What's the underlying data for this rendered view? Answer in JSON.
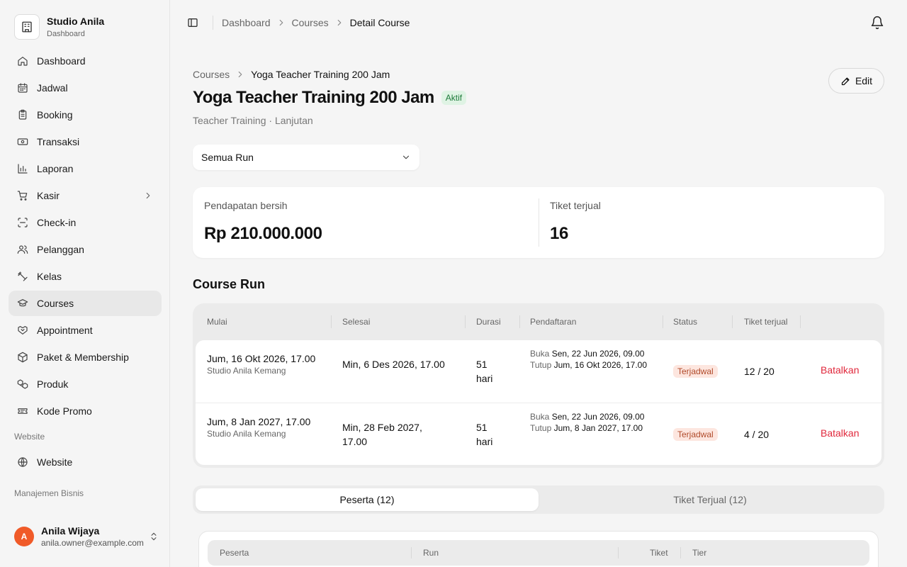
{
  "sidebar": {
    "brand": {
      "name": "Studio Anila",
      "sub": "Dashboard"
    },
    "items": [
      {
        "label": "Dashboard",
        "icon": "home-icon"
      },
      {
        "label": "Jadwal",
        "icon": "calendar-icon"
      },
      {
        "label": "Booking",
        "icon": "clipboard-icon"
      },
      {
        "label": "Transaksi",
        "icon": "banknote-icon"
      },
      {
        "label": "Laporan",
        "icon": "bar-chart-icon"
      },
      {
        "label": "Kasir",
        "icon": "cart-icon"
      },
      {
        "label": "Check-in",
        "icon": "scan-icon"
      },
      {
        "label": "Pelanggan",
        "icon": "users-icon"
      },
      {
        "label": "Kelas",
        "icon": "dumbbell-icon"
      },
      {
        "label": "Courses",
        "icon": "graduation-cap-icon"
      },
      {
        "label": "Appointment",
        "icon": "handshake-icon"
      },
      {
        "label": "Paket & Membership",
        "icon": "package-icon"
      },
      {
        "label": "Produk",
        "icon": "boxes-icon"
      },
      {
        "label": "Kode Promo",
        "icon": "ticket-icon"
      }
    ],
    "section_website": "Website",
    "website_item": {
      "label": "Website",
      "icon": "globe-icon"
    },
    "section_business": "Manajemen Bisnis",
    "user": {
      "initial": "A",
      "name": "Anila Wijaya",
      "email": "anila.owner@example.com"
    }
  },
  "topbar": {
    "breadcrumbs": [
      "Dashboard",
      "Courses",
      "Detail Course"
    ]
  },
  "page": {
    "breadcrumbs": [
      "Courses",
      "Yoga Teacher Training 200 Jam"
    ],
    "title": "Yoga Teacher Training 200 Jam",
    "status": "Aktif",
    "subtitle": "Teacher Training · Lanjutan",
    "edit_label": "Edit",
    "run_select": "Semua Run"
  },
  "stats": [
    {
      "label": "Pendapatan bersih",
      "value": "Rp 210.000.000"
    },
    {
      "label": "Tiket terjual",
      "value": "16"
    }
  ],
  "course_run": {
    "title": "Course Run",
    "columns": [
      "Mulai",
      "Selesai",
      "Durasi",
      "Pendaftaran",
      "Status",
      "Tiket terjual"
    ],
    "rows": [
      {
        "start": "Jum, 16 Okt 2026, 17.00",
        "location": "Studio Anila Kemang",
        "end": "Min, 6 Des 2026, 17.00",
        "duration": "51 hari",
        "open_label": "Buka",
        "open": "Sen, 22 Jun 2026, 09.00",
        "close_label": "Tutup",
        "close": "Jum, 16 Okt 2026, 17.00",
        "status": "Terjadwal",
        "tickets": "12 / 20",
        "action": "Batalkan"
      },
      {
        "start": "Jum, 8 Jan 2027, 17.00",
        "location": "Studio Anila Kemang",
        "end": "Min, 28 Feb 2027, 17.00",
        "duration": "51 hari",
        "open_label": "Buka",
        "open": "Sen, 22 Jun 2026, 09.00",
        "close_label": "Tutup",
        "close": "Jum, 8 Jan 2027, 17.00",
        "status": "Terjadwal",
        "tickets": "4 / 20",
        "action": "Batalkan"
      }
    ]
  },
  "tabs": [
    {
      "label": "Peserta (12)",
      "active": true
    },
    {
      "label": "Tiket Terjual (12)",
      "active": false
    }
  ],
  "peserta_table": {
    "columns": [
      "Peserta",
      "Run",
      "Tiket",
      "Tier"
    ]
  },
  "colors": {
    "accent_danger": "#e0283c",
    "badge_active_bg": "#dff3e4",
    "badge_scheduled_bg": "#fde6df",
    "avatar": "#f05a28"
  }
}
